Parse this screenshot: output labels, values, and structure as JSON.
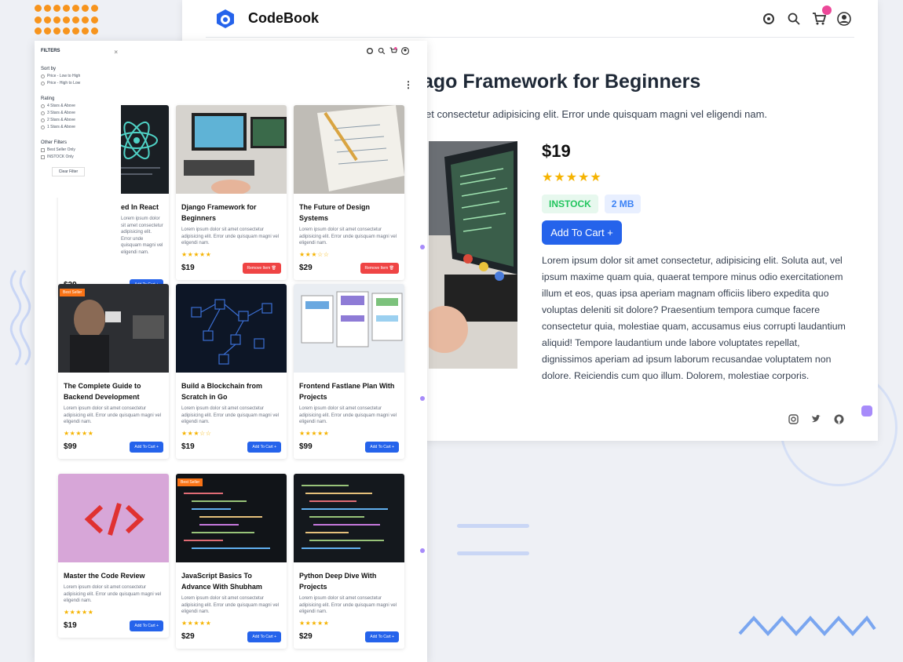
{
  "brand": {
    "name": "CodeBook"
  },
  "colors": {
    "accent": "#2563eb",
    "star": "#f5b301",
    "badge": "#ec4899",
    "orange": "#f97316"
  },
  "nav_icons": [
    "gear-icon",
    "search-icon",
    "cart-icon",
    "user-icon"
  ],
  "detail": {
    "title": "ago Framework for Beginners",
    "subtitle": "et consectetur adipisicing elit. Error unde quisquam magni vel eligendi nam.",
    "price": "$19",
    "stars": "★★★★★",
    "rating_value": 5,
    "tag_stock": "INSTOCK",
    "tag_size": "2 MB",
    "add_to_cart": "Add To Cart +",
    "description": "Lorem ipsum dolor sit amet consectetur, adipisicing elit. Soluta aut, vel ipsum maxime quam quia, quaerat tempore minus odio exercitationem illum et eos, quas ipsa aperiam magnam officiis libero expedita quo voluptas deleniti sit dolore? Praesentium tempora cumque facere consectetur quia, molestiae quam, accusamus eius corrupti laudantium aliquid! Tempore laudantium unde labore voluptates repellat, dignissimos aperiam ad ipsum laborum recusandae voluptatem non dolore. Reiciendis cum quo illum. Dolorem, molestiae corporis.",
    "social_icons": [
      "instagram-icon",
      "twitter-icon",
      "github-icon"
    ]
  },
  "filters": {
    "heading": "FILTERS",
    "close": "×",
    "sort_label": "Sort by",
    "sort_options": [
      "Price - Low to High",
      "Price - High to Low"
    ],
    "rating_label": "Rating",
    "rating_options": [
      "4 Stars & Above",
      "3 Stars & Above",
      "2 Stars & Above",
      "1 Stars & Above"
    ],
    "other_label": "Other Filters",
    "other_options": [
      "Best Seller Only",
      "INSTOCK Only"
    ],
    "clear": "Clear Filter"
  },
  "cards": [
    {
      "title": "ed In React",
      "desc": "Lorem ipsum dolor sit amet consectetur adipisicing elit. Error unde quisquam magni vel eligendi nam.",
      "stars": "",
      "price": "$29",
      "button": "Add To Cart +",
      "in_cart": false,
      "bestseller": false
    },
    {
      "title": "Django Framework for Beginners",
      "desc": "Lorem ipsum dolor sit amet consectetur adipisicing elit. Error unde quisquam magni vel eligendi nam.",
      "stars": "★★★★★",
      "price": "$19",
      "button": "Remove Item 🗑",
      "in_cart": true,
      "bestseller": false
    },
    {
      "title": "The Future of Design Systems",
      "desc": "Lorem ipsum dolor sit amet consectetur adipisicing elit. Error unde quisquam magni vel eligendi nam.",
      "stars": "★★★☆☆",
      "price": "$29",
      "button": "Remove Item 🗑",
      "in_cart": true,
      "bestseller": false
    },
    {
      "title": "The Complete Guide to Backend Development",
      "desc": "Lorem ipsum dolor sit amet consectetur adipisicing elit. Error unde quisquam magni vel eligendi nam.",
      "stars": "★★★★★",
      "price": "$99",
      "button": "Add To Cart +",
      "in_cart": false,
      "bestseller": true
    },
    {
      "title": "Build a Blockchain from Scratch in Go",
      "desc": "Lorem ipsum dolor sit amet consectetur adipisicing elit. Error unde quisquam magni vel eligendi nam.",
      "stars": "★★★☆☆",
      "price": "$19",
      "button": "Add To Cart +",
      "in_cart": false,
      "bestseller": false
    },
    {
      "title": "Frontend Fastlane Plan With Projects",
      "desc": "Lorem ipsum dolor sit amet consectetur adipisicing elit. Error unde quisquam magni vel eligendi nam.",
      "stars": "★★★★★",
      "price": "$99",
      "button": "Add To Cart +",
      "in_cart": false,
      "bestseller": false
    },
    {
      "title": "Master the Code Review",
      "desc": "Lorem ipsum dolor sit amet consectetur adipisicing elit. Error unde quisquam magni vel eligendi nam.",
      "stars": "★★★★★",
      "price": "$19",
      "button": "Add To Cart +",
      "in_cart": false,
      "bestseller": false
    },
    {
      "title": "JavaScript Basics To Advance With Shubham",
      "desc": "Lorem ipsum dolor sit amet consectetur adipisicing elit. Error unde quisquam magni vel eligendi nam.",
      "stars": "★★★★★",
      "price": "$29",
      "button": "Add To Cart +",
      "in_cart": false,
      "bestseller": true
    },
    {
      "title": "Python Deep Dive With Projects",
      "desc": "Lorem ipsum dolor sit amet consectetur adipisicing elit. Error unde quisquam magni vel eligendi nam.",
      "stars": "★★★★★",
      "price": "$29",
      "button": "Add To Cart +",
      "in_cart": false,
      "bestseller": false
    }
  ],
  "bestseller_label": "Best Seller"
}
